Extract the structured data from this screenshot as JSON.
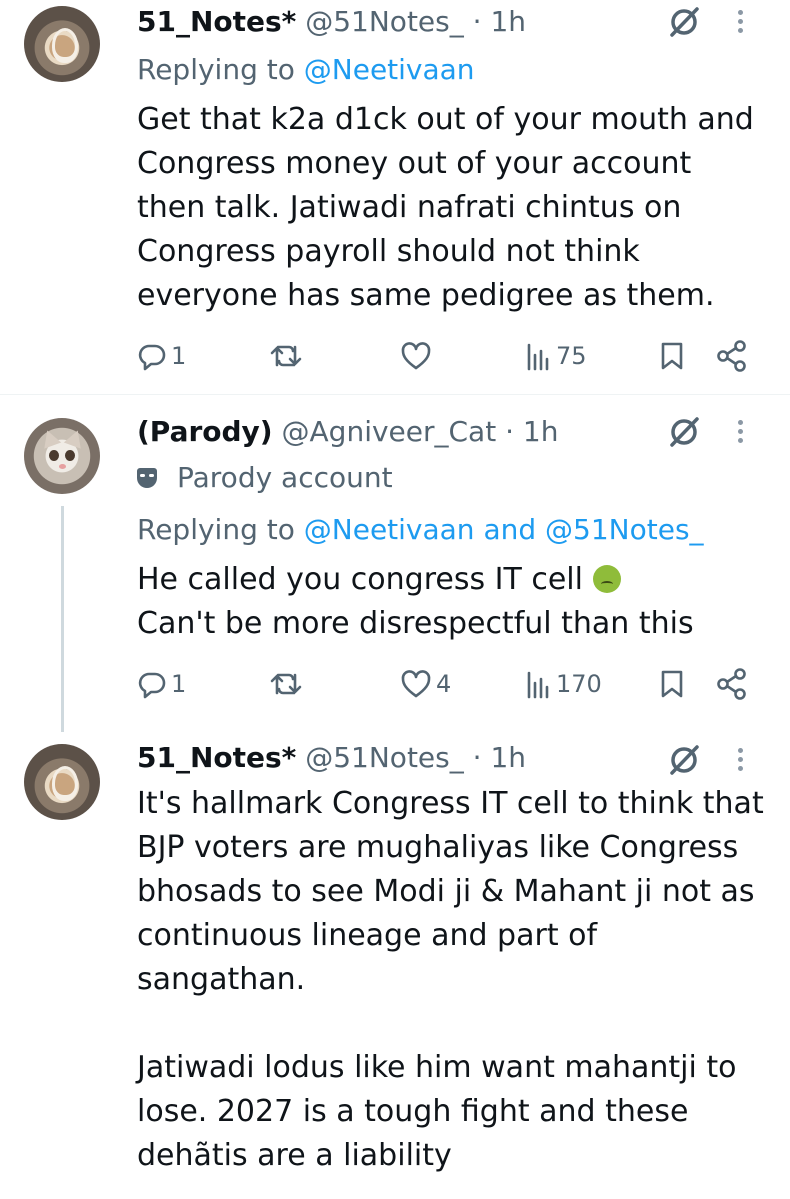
{
  "tweets": [
    {
      "name": "51_Notes*",
      "handle": "@51Notes_",
      "time": "· 1h",
      "avatar": "coffee-avatar",
      "replying_prefix": "Replying to ",
      "replying_to": "@Neetivaan",
      "text": "Get that k2a d1ck out of your mouth and\nCongress money out of your account\nthen talk. Jatiwadi nafrati chintus on\nCongress payroll should not think\neveryone has same pedigree as them.",
      "replies": "1",
      "retweets": "",
      "likes": "",
      "views": "75"
    },
    {
      "name": "(Parody)",
      "handle": "@Agniveer_Cat",
      "time": "· 1h",
      "avatar": "cat-avatar",
      "parody_label": "Parody account",
      "replying_prefix": "Replying to ",
      "replying_to": "@Neetivaan and @51Notes_",
      "text_line1": "He called you congress IT cell ",
      "text_line2": "Can't be more disrespectful than this",
      "replies": "1",
      "retweets": "",
      "likes": "4",
      "views": "170"
    },
    {
      "name": "51_Notes*",
      "handle": "@51Notes_",
      "time": "· 1h",
      "avatar": "coffee-avatar",
      "text": "It's hallmark Congress IT cell to think that\nBJP voters are mughaliyas like Congress\nbhosads to see Modi ji & Mahant ji not as\ncontinuous lineage and part of\nsangathan.\n\nJatiwadi lodus like him want mahantji to\nlose. 2027 is a tough fight and these\ndehãtis are a liability"
    }
  ],
  "colors": {
    "link": "#1d9bf0",
    "secondary": "#536471",
    "text": "#0f1419",
    "thread_line": "#cfd9de"
  }
}
